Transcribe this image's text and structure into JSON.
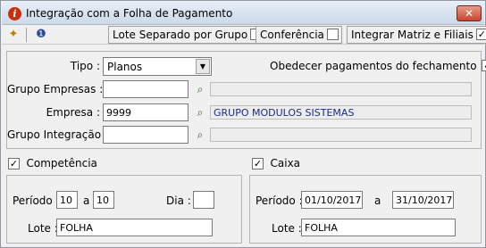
{
  "window": {
    "title": "Integração com a Folha de Pagamento",
    "close_label": "✕",
    "app_icon": "i"
  },
  "toolbar": {
    "tool1_icon": "✦",
    "tool2_icon": "❶",
    "lote_separado_label": "Lote Separado por Grupo",
    "lote_separado_checked": "",
    "conferencia_label": "Conferência",
    "conferencia_checked": "",
    "integrar_label": "Integrar Matriz e Filiais",
    "integrar_checked": "✓"
  },
  "top": {
    "tipo_label": "Tipo :",
    "tipo_value": "Planos",
    "obedecer_label": "Obedecer pagamentos do fechamento",
    "obedecer_checked": "✓",
    "grupo_empresas_label": "Grupo Empresas :",
    "grupo_empresas_value": "",
    "grupo_empresas_desc": "",
    "empresa_label": "Empresa :",
    "empresa_value": "9999",
    "empresa_desc": "GRUPO MODULOS SISTEMAS",
    "grupo_integracao_label": "Grupo Integração :",
    "grupo_integracao_value": "",
    "grupo_integracao_desc": "",
    "search_icon": "⌕"
  },
  "competencia": {
    "label": "Competência",
    "checked": "✓",
    "periodo_label": "Período :",
    "periodo_de": "10",
    "a_label": "a",
    "periodo_ate": "10",
    "dia_label": "Dia :",
    "dia_value": "",
    "lote_label": "Lote :",
    "lote_value": "FOLHA"
  },
  "caixa": {
    "label": "Caixa",
    "checked": "✓",
    "periodo_label": "Período :",
    "periodo_de": "01/10/2017",
    "a_label": "a",
    "periodo_ate": "31/10/2017",
    "lote_label": "Lote :",
    "lote_value": "FOLHA"
  }
}
